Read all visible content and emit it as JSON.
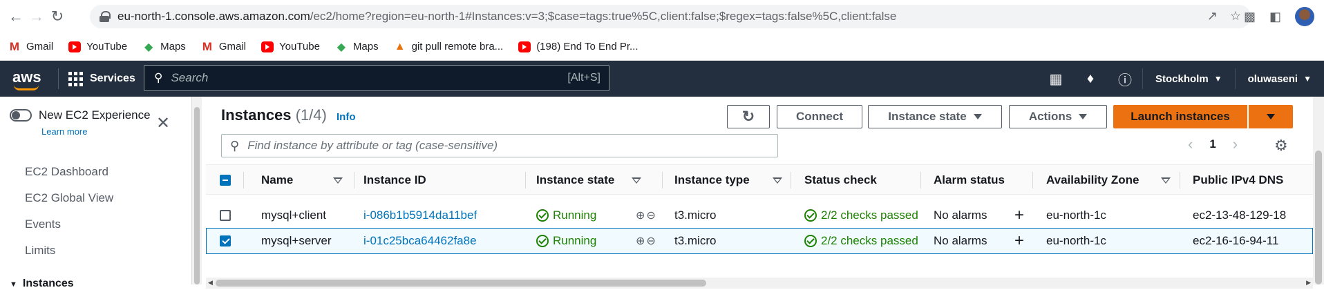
{
  "browser": {
    "url_host": "eu-north-1.console.aws.amazon.com",
    "url_path": "/ec2/home?region=eu-north-1#Instances:v=3;$case=tags:true%5C,client:false;$regex=tags:false%5C,client:false"
  },
  "bookmarks": [
    {
      "label": "Gmail",
      "icon": "gmail-icon"
    },
    {
      "label": "YouTube",
      "icon": "youtube-icon"
    },
    {
      "label": "Maps",
      "icon": "maps-icon"
    },
    {
      "label": "Gmail",
      "icon": "gmail-icon"
    },
    {
      "label": "YouTube",
      "icon": "youtube-icon"
    },
    {
      "label": "Maps",
      "icon": "maps-icon"
    },
    {
      "label": "git pull remote bra...",
      "icon": "git-icon"
    },
    {
      "label": "(198) End To End Pr...",
      "icon": "youtube-icon"
    }
  ],
  "awsnav": {
    "logo": "aws",
    "services": "Services",
    "search_placeholder": "Search",
    "search_shortcut": "[Alt+S]",
    "region": "Stockholm",
    "user": "oluwaseni"
  },
  "sidebar": {
    "toggle_label": "New EC2 Experience",
    "learn_more": "Learn more",
    "items": [
      "EC2 Dashboard",
      "EC2 Global View",
      "Events",
      "Limits"
    ],
    "section": "Instances"
  },
  "main": {
    "title": "Instances",
    "count": "(1/4)",
    "info": "Info",
    "buttons": {
      "connect": "Connect",
      "instance_state": "Instance state",
      "actions": "Actions",
      "launch": "Launch instances"
    },
    "filter_placeholder": "Find instance by attribute or tag (case-sensitive)",
    "page": "1"
  },
  "table": {
    "columns": [
      "Name",
      "Instance ID",
      "Instance state",
      "Instance type",
      "Status check",
      "Alarm status",
      "Availability Zone",
      "Public IPv4 DNS"
    ],
    "rows": [
      {
        "name": "mysql+client",
        "id": "i-086b1b5914da11bef",
        "state": "Running",
        "type": "t3.micro",
        "status": "2/2 checks passed",
        "alarm": "No alarms",
        "az": "eu-north-1c",
        "dns": "ec2-13-48-129-18",
        "selected": false
      },
      {
        "name": "mysql+server",
        "id": "i-01c25bca64462fa8e",
        "state": "Running",
        "type": "t3.micro",
        "status": "2/2 checks passed",
        "alarm": "No alarms",
        "az": "eu-north-1c",
        "dns": "ec2-16-16-94-11",
        "selected": true
      }
    ]
  },
  "colors": {
    "aws_nav": "#232f3e",
    "accent_orange": "#ec7211",
    "link_blue": "#0073bb",
    "success_green": "#1d8102"
  }
}
